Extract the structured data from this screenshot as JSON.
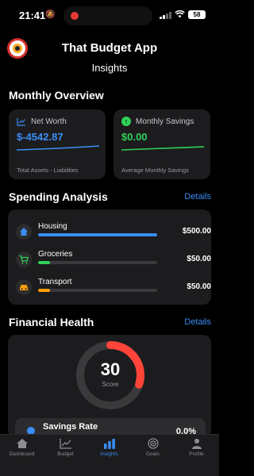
{
  "status_bar": {
    "time": "21:41",
    "battery": "58"
  },
  "header": {
    "app_title": "That Budget App",
    "screen_title": "Insights"
  },
  "monthly_overview": {
    "title": "Monthly Overview",
    "net_worth": {
      "label": "Net Worth",
      "value": "$-4542.87",
      "caption": "Total Assets - Liabilities",
      "color": "#3b8df5"
    },
    "monthly_savings": {
      "label": "Monthly Savings",
      "value": "$0.00",
      "caption": "Average Monthly Savings",
      "color": "#30d158"
    }
  },
  "spending_analysis": {
    "title": "Spending Analysis",
    "details": "Details",
    "items": [
      {
        "name": "Housing",
        "amount": "$500.00",
        "progress": 1.0,
        "color": "#3b8df5",
        "icon": "house-icon"
      },
      {
        "name": "Groceries",
        "amount": "$50.00",
        "progress": 0.1,
        "color": "#30d158",
        "icon": "cart-icon"
      },
      {
        "name": "Transport",
        "amount": "$50.00",
        "progress": 0.1,
        "color": "#ff9f0a",
        "icon": "car-icon"
      }
    ]
  },
  "financial_health": {
    "title": "Financial Health",
    "details": "Details",
    "score": "30",
    "score_label": "Score",
    "score_fraction": 0.3,
    "score_color": "#ff453a",
    "metrics": [
      {
        "name": "Savings Rate",
        "value": "0.0%",
        "icon": "savings-icon"
      }
    ]
  },
  "tab_bar": {
    "tabs": [
      {
        "label": "Dashboard",
        "icon": "house-icon",
        "active": false
      },
      {
        "label": "Budget",
        "icon": "chart-line-icon",
        "active": false
      },
      {
        "label": "Insights",
        "icon": "bar-chart-icon",
        "active": true
      },
      {
        "label": "Goals",
        "icon": "target-icon",
        "active": false
      },
      {
        "label": "Profile",
        "icon": "person-icon",
        "active": false
      }
    ],
    "active_color": "#3b8df5"
  }
}
